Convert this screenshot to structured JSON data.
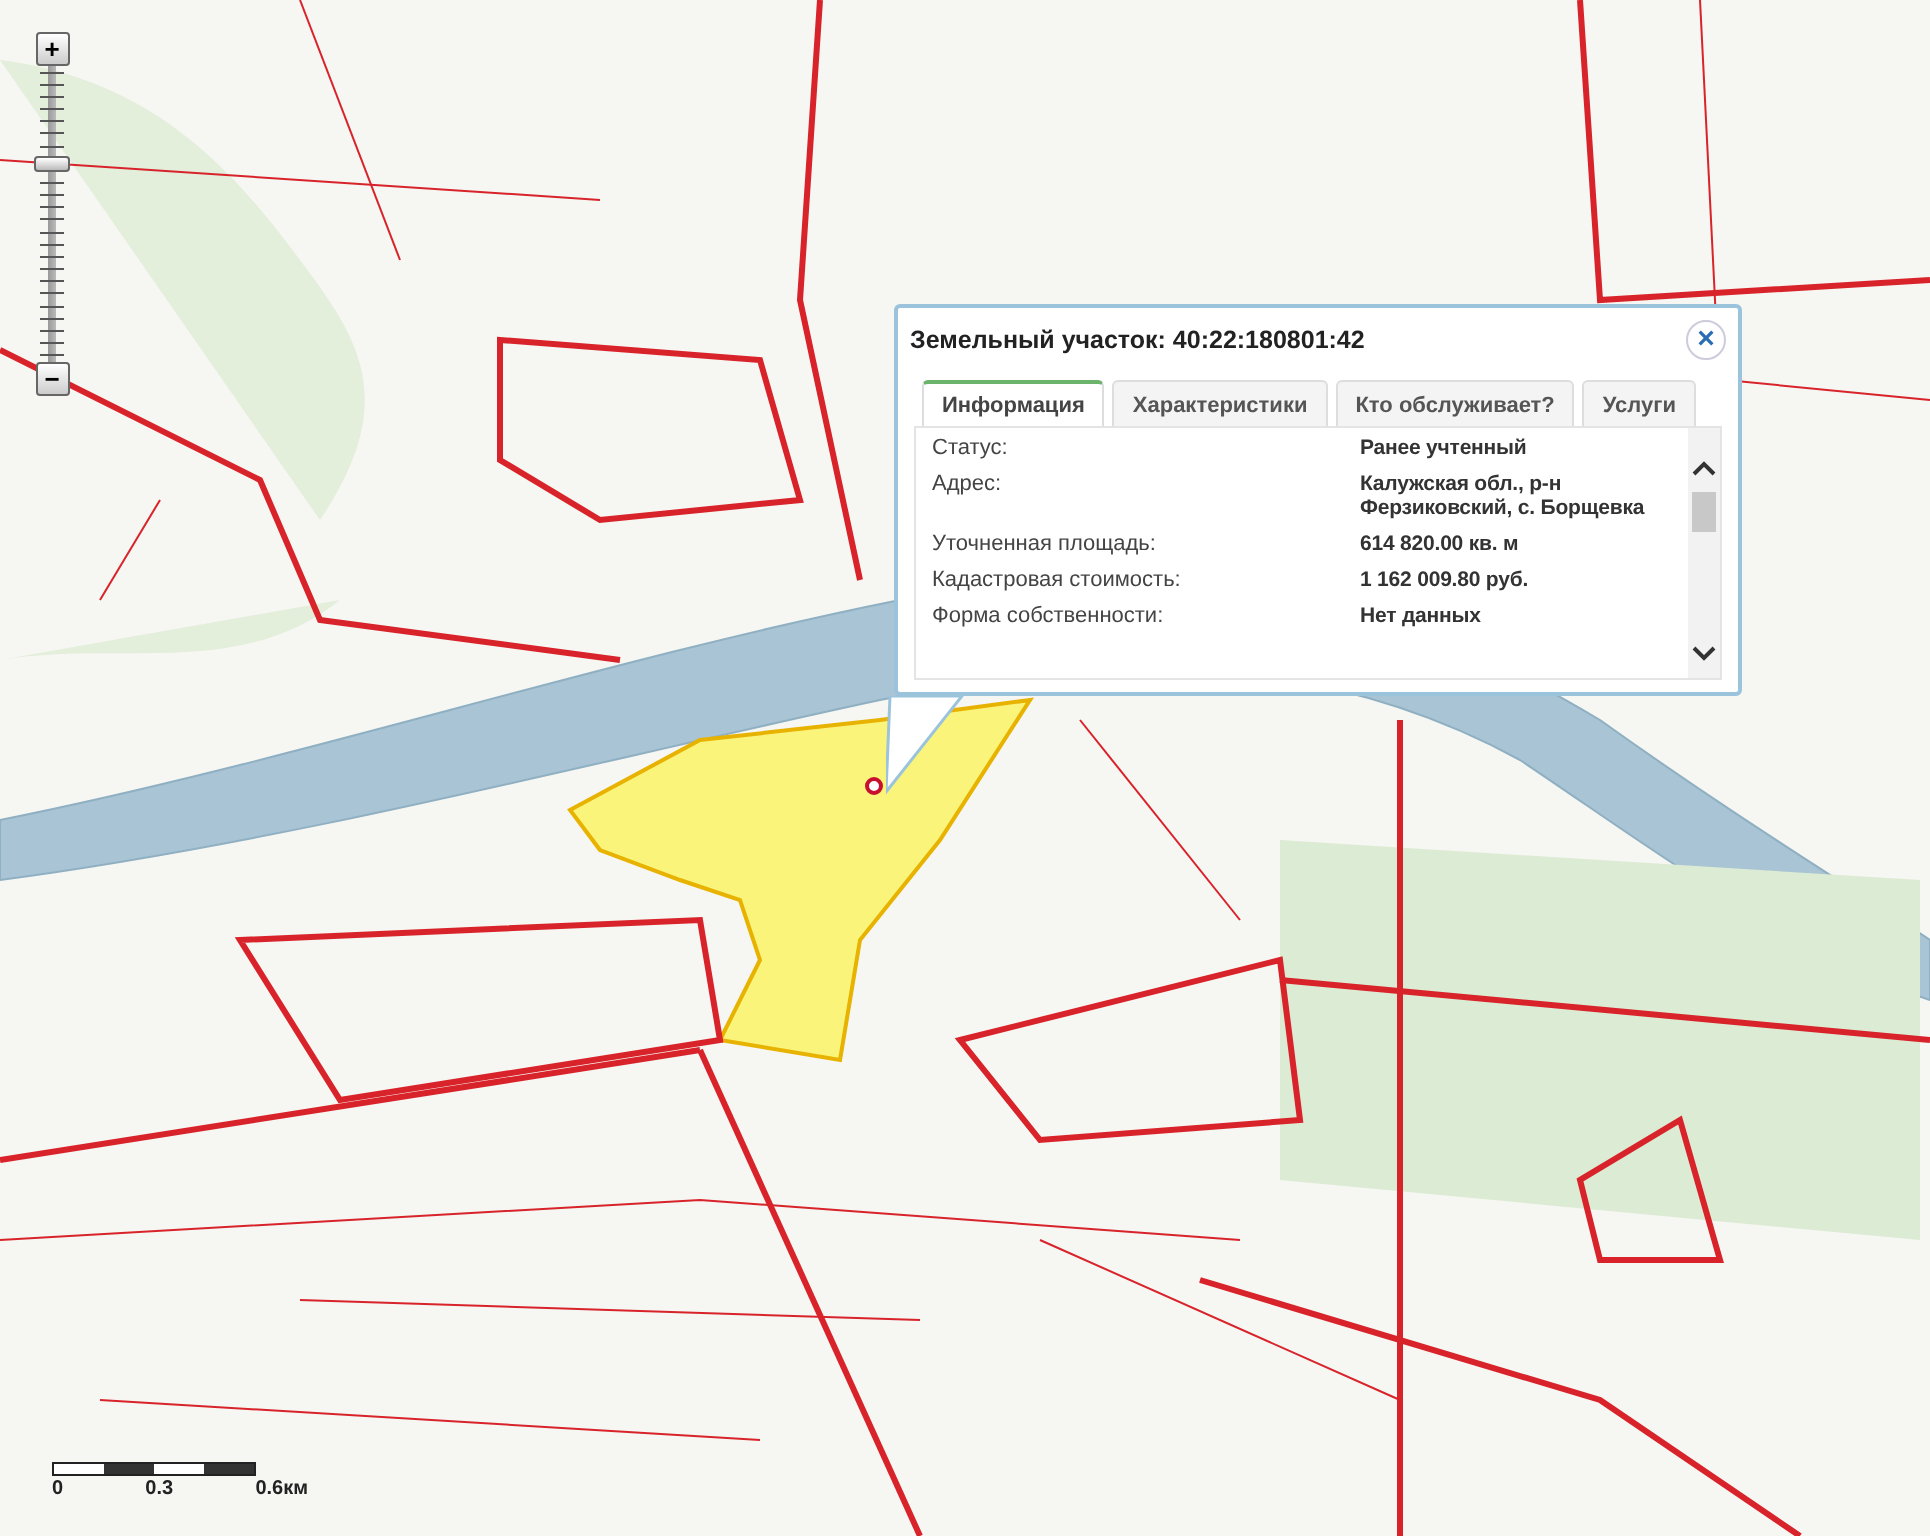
{
  "zoom": {
    "plus": "+",
    "minus": "−",
    "level": 0.67
  },
  "popup": {
    "title": "Земельный участок: 40:22:180801:42",
    "close": "×",
    "tabs": [
      {
        "label": "Информация",
        "selected": true
      },
      {
        "label": "Характеристики",
        "selected": false
      },
      {
        "label": "Кто обслуживает?",
        "selected": false
      },
      {
        "label": "Услуги",
        "selected": false
      }
    ],
    "rows": [
      {
        "label": "Статус:",
        "value": "Ранее учтенный"
      },
      {
        "label": "Адрес:",
        "value": "Калужская обл., р-н Ферзиковский, с. Борщевка"
      },
      {
        "label": "Уточненная площадь:",
        "value": "614 820.00 кв. м"
      },
      {
        "label": "Кадастровая стоимость:",
        "value": "1 162 009.80 руб."
      },
      {
        "label": "Форма собственности:",
        "value": "Нет данных"
      }
    ]
  },
  "scale": {
    "labels": [
      "0",
      "0.3",
      "0.6км"
    ]
  }
}
